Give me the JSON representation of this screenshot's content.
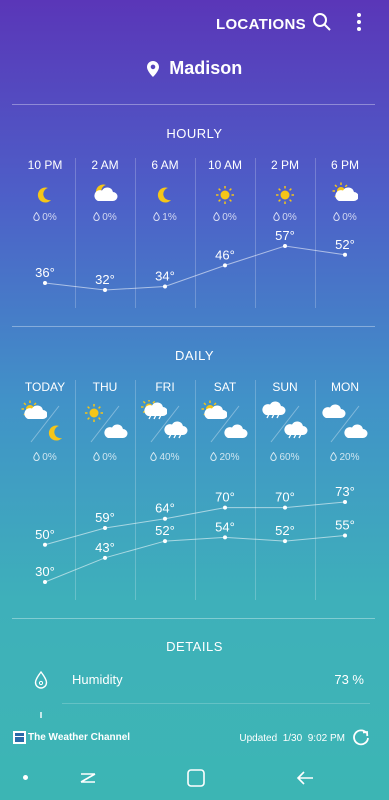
{
  "header": {
    "locations_label": "LOCATIONS",
    "location_name": "Madison"
  },
  "hourly": {
    "title": "HOURLY",
    "items": [
      {
        "time": "10 PM",
        "icon": "moon-icon",
        "precip": "0%",
        "temp": "36°"
      },
      {
        "time": "2 AM",
        "icon": "moon-cloud-icon",
        "precip": "0%",
        "temp": "32°"
      },
      {
        "time": "6 AM",
        "icon": "moon-icon",
        "precip": "1%",
        "temp": "34°"
      },
      {
        "time": "10 AM",
        "icon": "sun-icon",
        "precip": "0%",
        "temp": "46°"
      },
      {
        "time": "2 PM",
        "icon": "sun-icon",
        "precip": "0%",
        "temp": "57°"
      },
      {
        "time": "6 PM",
        "icon": "sun-cloud-icon",
        "precip": "0%",
        "temp": "52°"
      }
    ]
  },
  "daily": {
    "title": "DAILY",
    "items": [
      {
        "day": "TODAY",
        "day_icon": "sun-cloud-icon",
        "night_icon": "moon-icon",
        "precip": "0%",
        "high": "50°",
        "low": "30°"
      },
      {
        "day": "THU",
        "day_icon": "sun-icon",
        "night_icon": "cloud-icon",
        "precip": "0%",
        "high": "59°",
        "low": "43°"
      },
      {
        "day": "FRI",
        "day_icon": "sun-cloud-rain-icon",
        "night_icon": "cloud-rain-icon",
        "precip": "40%",
        "high": "64°",
        "low": "52°"
      },
      {
        "day": "SAT",
        "day_icon": "sun-cloud-icon",
        "night_icon": "cloud-icon",
        "precip": "20%",
        "high": "70°",
        "low": "54°"
      },
      {
        "day": "SUN",
        "day_icon": "cloud-rain-icon",
        "night_icon": "cloud-rain-icon",
        "precip": "60%",
        "high": "70°",
        "low": "52°"
      },
      {
        "day": "MON",
        "day_icon": "cloud-icon",
        "night_icon": "cloud-icon",
        "precip": "20%",
        "high": "73°",
        "low": "55°"
      }
    ]
  },
  "details": {
    "title": "DETAILS",
    "humidity_label": "Humidity",
    "humidity_value": "73 %"
  },
  "footer": {
    "provider": "The Weather Channel",
    "updated_label": "Updated",
    "updated_date": "1/30",
    "updated_time": "9:02 PM"
  },
  "colors": {
    "sun": "#f5c518",
    "moon": "#f5c518",
    "cloud": "#ffffff"
  }
}
